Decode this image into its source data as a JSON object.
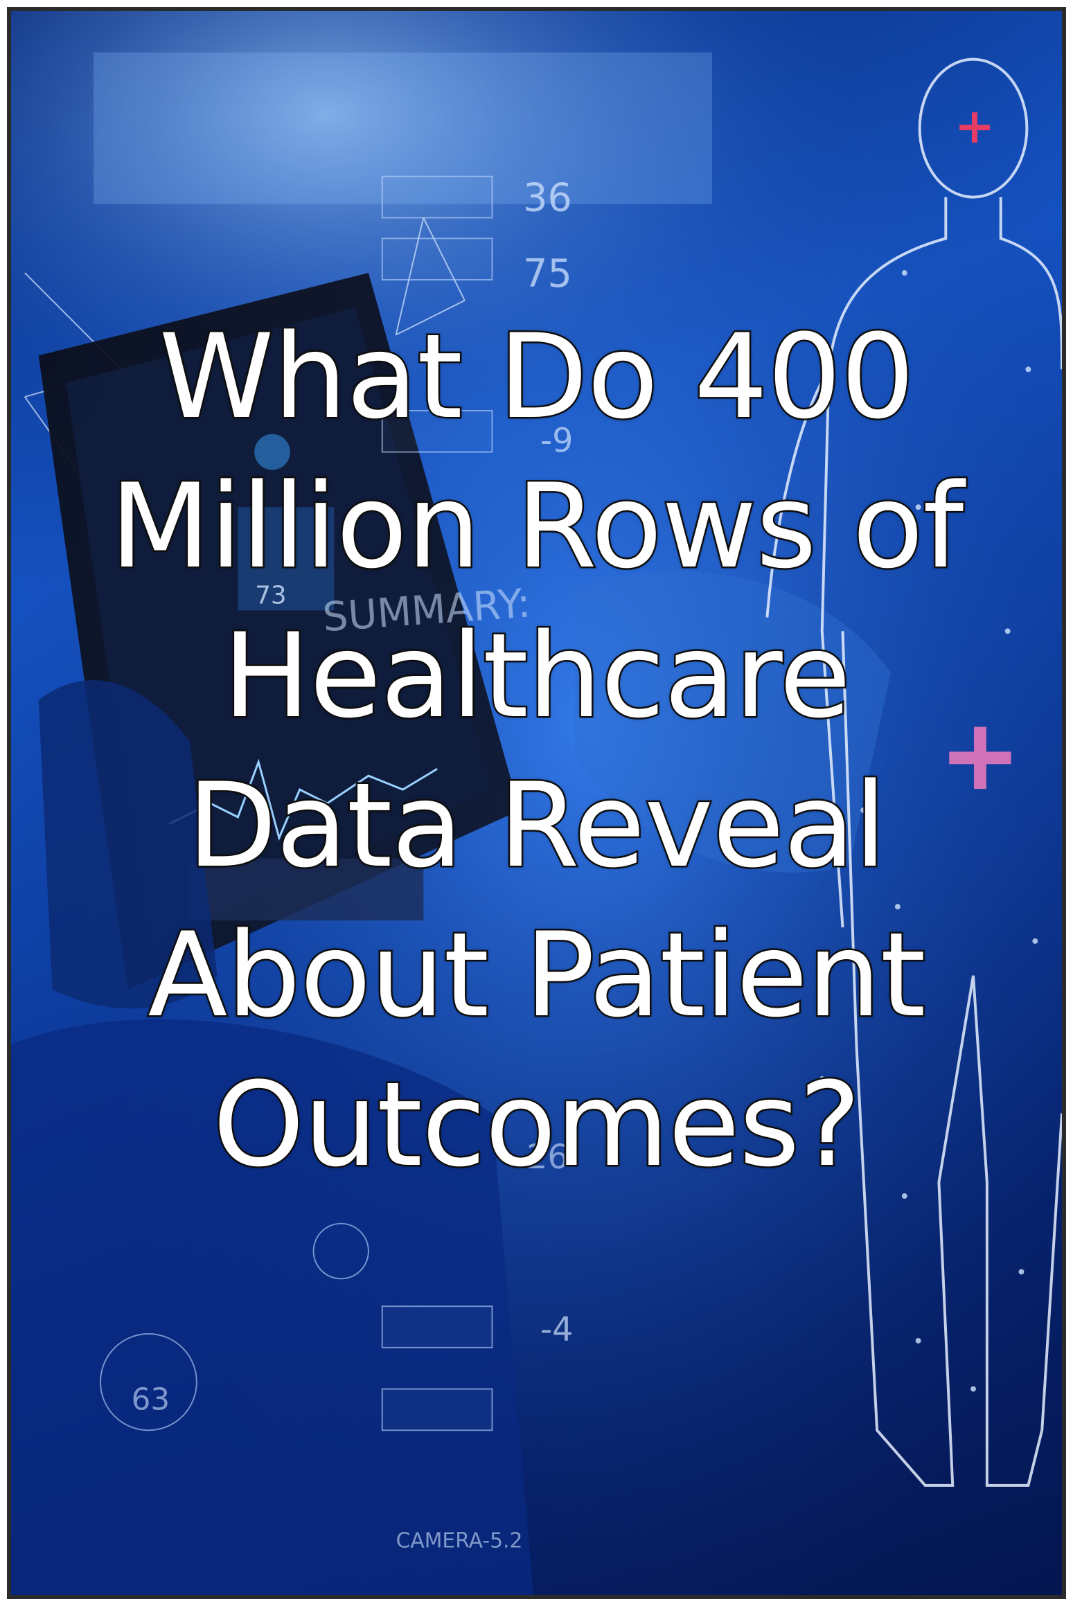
{
  "title_lines": [
    "What Do 400",
    "Million Rows of",
    "Healthcare",
    "Data Reveal",
    "About Patient",
    "Outcomes?"
  ],
  "background_labels": {
    "num_36": "36",
    "num_75": "75",
    "num_neg9": "-9",
    "num_73": "73",
    "summary": "SUMMARY:",
    "num_26": "26",
    "num_neg4": "-4",
    "num_63": "63",
    "camera": "CAMERA-5.2"
  },
  "colors": {
    "background_deep": "#06206a",
    "background_mid": "#1553c4",
    "hud_line": "#bcd8ff",
    "title_fill": "#ffffff",
    "title_stroke": "#111111",
    "accent_pink": "#ff7fbf",
    "accent_red": "#ff3b5c"
  }
}
